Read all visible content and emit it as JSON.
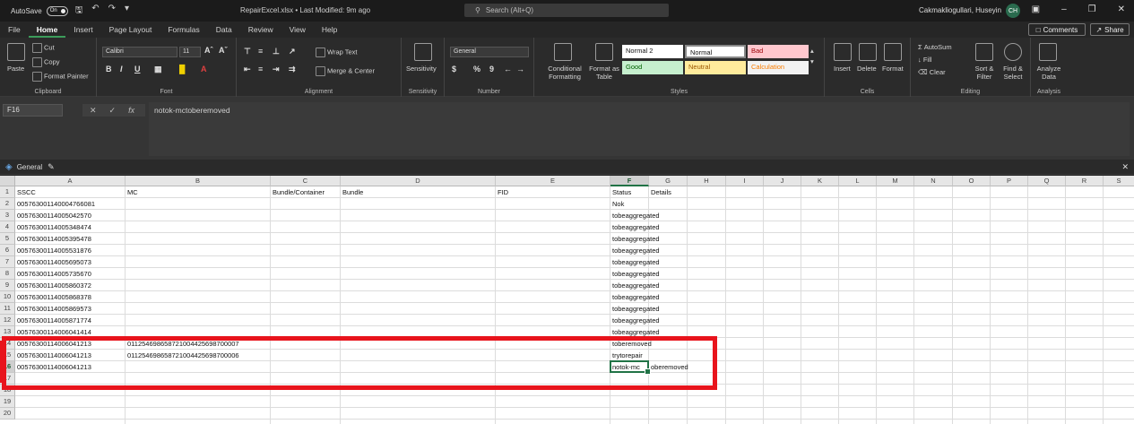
{
  "titlebar": {
    "autosave_label": "AutoSave",
    "autosave_state": "On",
    "document_title": "RepairExcel.xlsx • Last Modified: 9m ago",
    "search_placeholder": "Search (Alt+Q)",
    "user_name": "Cakmakliogullari, Huseyin",
    "user_initials": "CH"
  },
  "menu": {
    "tabs": [
      {
        "label": "File"
      },
      {
        "label": "Home"
      },
      {
        "label": "Insert"
      },
      {
        "label": "Page Layout"
      },
      {
        "label": "Formulas"
      },
      {
        "label": "Data"
      },
      {
        "label": "Review"
      },
      {
        "label": "View"
      },
      {
        "label": "Help"
      }
    ],
    "comments_label": "Comments",
    "share_label": "Share"
  },
  "ribbon": {
    "clipboard": {
      "group": "Clipboard",
      "paste": "Paste",
      "cut": "Cut",
      "copy": "Copy",
      "format_painter": "Format Painter"
    },
    "font": {
      "group": "Font",
      "family": "Calibri",
      "size": "11",
      "bold": "B",
      "italic": "I",
      "underline": "U"
    },
    "alignment": {
      "group": "Alignment",
      "wrap_text": "Wrap Text",
      "merge_center": "Merge & Center"
    },
    "sensitivity": {
      "group": "Sensitivity",
      "label": "Sensitivity"
    },
    "number": {
      "group": "Number",
      "format": "General",
      "currency": "$",
      "percent": "%",
      "comma": "9"
    },
    "styles": {
      "group": "Styles",
      "conditional": "Conditional Formatting",
      "format_table": "Format as Table",
      "cells": [
        {
          "label": "Normal 2",
          "bg": "#ffffff",
          "fg": "#111111"
        },
        {
          "label": "Normal",
          "bg": "#ffffff",
          "fg": "#111111"
        },
        {
          "label": "Bad",
          "bg": "#ffc7ce",
          "fg": "#9c0006"
        },
        {
          "label": "Good",
          "bg": "#c6efce",
          "fg": "#006100"
        },
        {
          "label": "Neutral",
          "bg": "#ffeb9c",
          "fg": "#9c5700"
        },
        {
          "label": "Calculation",
          "bg": "#f2f2f2",
          "fg": "#fa7d00"
        }
      ]
    },
    "cells": {
      "group": "Cells",
      "insert": "Insert",
      "delete": "Delete",
      "format": "Format"
    },
    "editing": {
      "group": "Editing",
      "autosum": "AutoSum",
      "fill": "Fill",
      "clear": "Clear",
      "sort_filter": "Sort & Filter",
      "find_select": "Find & Select"
    },
    "analysis": {
      "group": "Analysis",
      "analyze": "Analyze Data"
    }
  },
  "formula_bar": {
    "name_box": "F16",
    "fx": "fx",
    "content": "notok-mctoberemoved"
  },
  "sheet_view": {
    "name": "General"
  },
  "sheet": {
    "columns": [
      "A",
      "B",
      "C",
      "D",
      "E",
      "F",
      "G",
      "H",
      "I",
      "J",
      "K",
      "L",
      "M",
      "N",
      "O",
      "P",
      "Q",
      "R",
      "S"
    ],
    "rows": [
      "1",
      "2",
      "3",
      "4",
      "5",
      "6",
      "7",
      "8",
      "9",
      "10",
      "11",
      "12",
      "13",
      "14",
      "15",
      "16",
      "17",
      "18",
      "19",
      "20"
    ],
    "cells": [
      {
        "r": 0,
        "c": 0,
        "v": "SSCC"
      },
      {
        "r": 0,
        "c": 1,
        "v": "MC"
      },
      {
        "r": 0,
        "c": 2,
        "v": "Bundle/Container"
      },
      {
        "r": 0,
        "c": 3,
        "v": "Bundle"
      },
      {
        "r": 0,
        "c": 4,
        "v": "FID"
      },
      {
        "r": 0,
        "c": 5,
        "v": "Status"
      },
      {
        "r": 0,
        "c": 6,
        "v": "Details"
      },
      {
        "r": 1,
        "c": 0,
        "v": "005763001140004766081"
      },
      {
        "r": 1,
        "c": 5,
        "v": "Nok"
      },
      {
        "r": 2,
        "c": 0,
        "v": "00576300114005042570"
      },
      {
        "r": 2,
        "c": 5,
        "v": "tobeaggregated"
      },
      {
        "r": 3,
        "c": 0,
        "v": "00576300114005348474"
      },
      {
        "r": 3,
        "c": 5,
        "v": "tobeaggregated"
      },
      {
        "r": 4,
        "c": 0,
        "v": "00576300114005395478"
      },
      {
        "r": 4,
        "c": 5,
        "v": "tobeaggregated"
      },
      {
        "r": 5,
        "c": 0,
        "v": "00576300114005531876"
      },
      {
        "r": 5,
        "c": 5,
        "v": "tobeaggregated"
      },
      {
        "r": 6,
        "c": 0,
        "v": "00576300114005695073"
      },
      {
        "r": 6,
        "c": 5,
        "v": "tobeaggregated"
      },
      {
        "r": 7,
        "c": 0,
        "v": "00576300114005735670"
      },
      {
        "r": 7,
        "c": 5,
        "v": "tobeaggregated"
      },
      {
        "r": 8,
        "c": 0,
        "v": "00576300114005860372"
      },
      {
        "r": 8,
        "c": 5,
        "v": "tobeaggregated"
      },
      {
        "r": 9,
        "c": 0,
        "v": "00576300114005868378"
      },
      {
        "r": 9,
        "c": 5,
        "v": "tobeaggregated"
      },
      {
        "r": 10,
        "c": 0,
        "v": "00576300114005869573"
      },
      {
        "r": 10,
        "c": 5,
        "v": "tobeaggregated"
      },
      {
        "r": 11,
        "c": 0,
        "v": "00576300114005871774"
      },
      {
        "r": 11,
        "c": 5,
        "v": "tobeaggregated"
      },
      {
        "r": 12,
        "c": 0,
        "v": "00576300114006041414"
      },
      {
        "r": 12,
        "c": 5,
        "v": "tobeaggregated"
      },
      {
        "r": 13,
        "c": 0,
        "v": "00576300114006041213"
      },
      {
        "r": 13,
        "c": 1,
        "v": "011254698658721004425698700007"
      },
      {
        "r": 13,
        "c": 5,
        "v": "toberemoved"
      },
      {
        "r": 14,
        "c": 0,
        "v": "00576300114006041213"
      },
      {
        "r": 14,
        "c": 1,
        "v": "011254698658721004425698700006"
      },
      {
        "r": 14,
        "c": 5,
        "v": "trytorepair"
      },
      {
        "r": 15,
        "c": 0,
        "v": "00576300114006041213"
      },
      {
        "r": 15,
        "c": 5,
        "v": "notok-mc"
      },
      {
        "r": 15,
        "c": 6,
        "v": "oberemoved"
      }
    ],
    "active_cell": "F16",
    "accent_color": "#217346",
    "highlight_color": "#e8141c"
  }
}
